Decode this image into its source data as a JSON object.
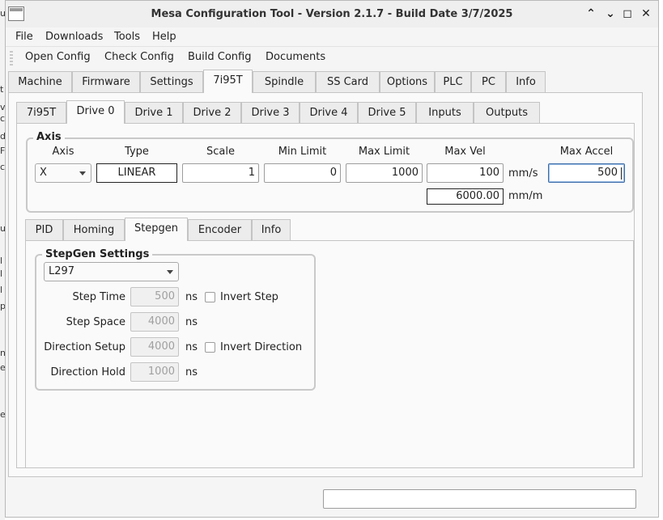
{
  "window": {
    "title": "Mesa Configuration Tool - Version 2.1.7 - Build Date 3/7/2025",
    "icons": [
      "app-window-icon",
      "minimize-icon",
      "maximize-icon",
      "restore-icon",
      "close-icon"
    ],
    "controls": {
      "minimize": "⌃",
      "restore": "⌄",
      "maximize": "◻",
      "close": "✕"
    }
  },
  "menubar": [
    "File",
    "Downloads",
    "Tools",
    "Help"
  ],
  "toolbar": [
    "Open Config",
    "Check Config",
    "Build Config",
    "Documents"
  ],
  "main_tabs": [
    "Machine",
    "Firmware",
    "Settings",
    "7i95T",
    "Spindle",
    "SS Card",
    "Options",
    "PLC",
    "PC",
    "Info"
  ],
  "main_active": "7i95T",
  "sub_tabs": [
    "7i95T",
    "Drive 0",
    "Drive 1",
    "Drive 2",
    "Drive 3",
    "Drive 4",
    "Drive 5",
    "Inputs",
    "Outputs"
  ],
  "sub_active": "Drive 0",
  "axis": {
    "group_title": "Axis",
    "headers": {
      "axis": "Axis",
      "type": "Type",
      "scale": "Scale",
      "min_limit": "Min Limit",
      "max_limit": "Max Limit",
      "max_vel": "Max Vel",
      "max_accel": "Max Accel"
    },
    "axis_value": "X",
    "type_value": "LINEAR",
    "scale": "1",
    "min_limit": "0",
    "max_limit": "1000",
    "max_vel": "100",
    "vel_unit": "mm/s",
    "max_accel": "500",
    "max_vel_mm_min": "6000.00",
    "mm_min_unit": "mm/m"
  },
  "drive_tabs": [
    "PID",
    "Homing",
    "Stepgen",
    "Encoder",
    "Info"
  ],
  "drive_active": "Stepgen",
  "stepgen": {
    "group_title": "StepGen Settings",
    "driver": "L297",
    "step_time": {
      "label": "Step Time",
      "value": "500",
      "unit": "ns"
    },
    "step_space": {
      "label": "Step Space",
      "value": "4000",
      "unit": "ns"
    },
    "direction_setup": {
      "label": "Direction Setup",
      "value": "4000",
      "unit": "ns"
    },
    "direction_hold": {
      "label": "Direction Hold",
      "value": "1000",
      "unit": "ns"
    },
    "invert_step": {
      "label": "Invert Step",
      "checked": false
    },
    "invert_direction": {
      "label": "Invert Direction",
      "checked": false
    }
  },
  "status": {
    "value": ""
  }
}
